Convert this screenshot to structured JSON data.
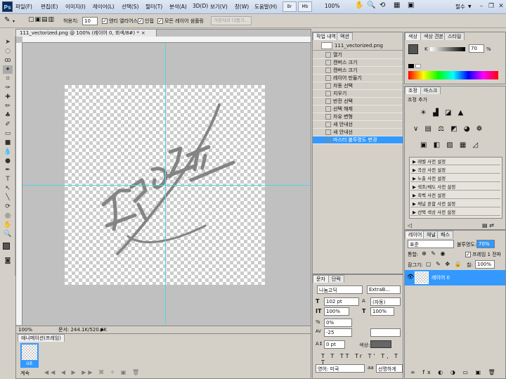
{
  "app": {
    "logo": "Ps"
  },
  "menu": [
    "파일(F)",
    "편집(E)",
    "이미지(I)",
    "레이어(L)",
    "선택(S)",
    "필터(T)",
    "분석(A)",
    "3D(D)",
    "보기(V)",
    "창(W)",
    "도움말(H)"
  ],
  "menubar_buttons": [
    "Br",
    "Mb"
  ],
  "menubar_zoom": "100%",
  "workspace": "필수",
  "options": {
    "tolerance_label": "허용치:",
    "tolerance_value": "10",
    "antialias": "앤티 앨리어스",
    "contiguous": "인접",
    "all_layers": "모든 레이어 샘플링",
    "refine_edge": "가장자리 다듬기..."
  },
  "document": {
    "tab_title": "111_vectorized.png @ 100% (레이어 0, 회색/8#) *",
    "zoom": "100%",
    "doc_size": "문서: 244.1K/520.4K"
  },
  "animation": {
    "tab": "애니메이션(프레임)",
    "frame_time": "0초",
    "loop": "계속"
  },
  "history": {
    "tabs": [
      "작업 내역",
      "액션"
    ],
    "snapshot": "111_vectorized.png",
    "items": [
      "열기",
      "캔버스 크기",
      "캔버스 크기",
      "레이어 만들기",
      "자동 선택",
      "지우기",
      "반전 선택",
      "선택 해제",
      "자유 변형",
      "새 안내선",
      "새 안내선",
      "마스터 불투명도 변경"
    ],
    "selected_index": 11
  },
  "character": {
    "tabs": [
      "문자",
      "단락"
    ],
    "font": "나눔고딕",
    "style": "ExtraB...",
    "size": "102 pt",
    "leading": "(자동)",
    "vscale": "100%",
    "hscale": "100%",
    "baseline_pct": "0%",
    "tracking": "-25",
    "baseline_shift": "0 pt",
    "color_label": "색상:",
    "language": "영어: 미국",
    "antialias": "선명하게"
  },
  "color": {
    "tabs": [
      "색상",
      "색상 견본",
      "스타일"
    ],
    "channel": "K",
    "value": "70",
    "unit": "%"
  },
  "adjustments": {
    "tabs": [
      "조정",
      "마스크"
    ],
    "title": "조정 추가",
    "presets": [
      "레벨 사전 설정",
      "곡선 사전 설정",
      "노출 사전 설정",
      "색조/채도 사전 설정",
      "흑백 사전 설정",
      "채널 혼합 사전 설정",
      "선택 색상 사전 설정"
    ]
  },
  "layers": {
    "tabs": [
      "레이어",
      "채널",
      "패스"
    ],
    "blend": "표준",
    "opacity_label": "불투명도:",
    "opacity": "70%",
    "unify_label": "통합:",
    "propagate": "프레임 1 전파",
    "lock_label": "잠그기:",
    "fill_label": "칠:",
    "fill": "100%",
    "layer_name": "레이어 0"
  },
  "colors": {
    "accent": "#3399ff",
    "guide": "#4cd8e0"
  }
}
